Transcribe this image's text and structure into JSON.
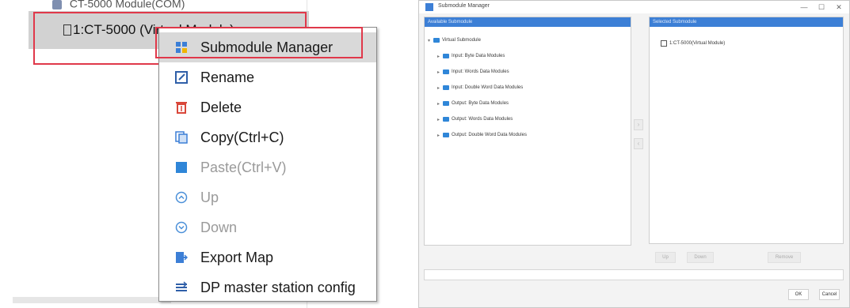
{
  "left": {
    "tree_top_row": "CT-5000 Module(COM)",
    "tree_selected_node": "1:CT-5000 (Virtual Module)",
    "context_menu": [
      {
        "label": "Submodule Manager",
        "icon": "submodule-icon",
        "enabled": true
      },
      {
        "label": "Rename",
        "icon": "rename-icon",
        "enabled": true
      },
      {
        "label": "Delete",
        "icon": "delete-icon",
        "enabled": true
      },
      {
        "label": "Copy(Ctrl+C)",
        "icon": "copy-icon",
        "enabled": true
      },
      {
        "label": "Paste(Ctrl+V)",
        "icon": "paste-icon",
        "enabled": false
      },
      {
        "label": "Up",
        "icon": "up-icon",
        "enabled": false
      },
      {
        "label": "Down",
        "icon": "down-icon",
        "enabled": false
      },
      {
        "label": "Export Map",
        "icon": "export-icon",
        "enabled": true
      },
      {
        "label": "DP master station config",
        "icon": "dp-config-icon",
        "enabled": true
      }
    ]
  },
  "dialog": {
    "title": "Submodule Manager",
    "win_buttons": {
      "minimize": "—",
      "maximize": "☐",
      "close": "✕"
    },
    "left_pane": {
      "header": "Available Submodule",
      "root": "Virtual Submodule",
      "children": [
        "Input: Byte Data Modules",
        "Input: Words Data Modules",
        "Input: Double Word Data Modules",
        "Output: Byte Data Modules",
        "Output: Words Data Modules",
        "Output: Double Word Data Modules"
      ]
    },
    "right_pane": {
      "header": "Selected Submodule",
      "items": [
        "1:CT-5000(Virtual Module)"
      ]
    },
    "buttons": {
      "up": "Up",
      "down": "Down",
      "remove": "Remove",
      "ok": "OK",
      "cancel": "Cancel"
    }
  },
  "colors": {
    "highlight_border": "#e0384a",
    "accent_blue": "#3c7fd6",
    "folder_blue": "#2f86d8"
  }
}
